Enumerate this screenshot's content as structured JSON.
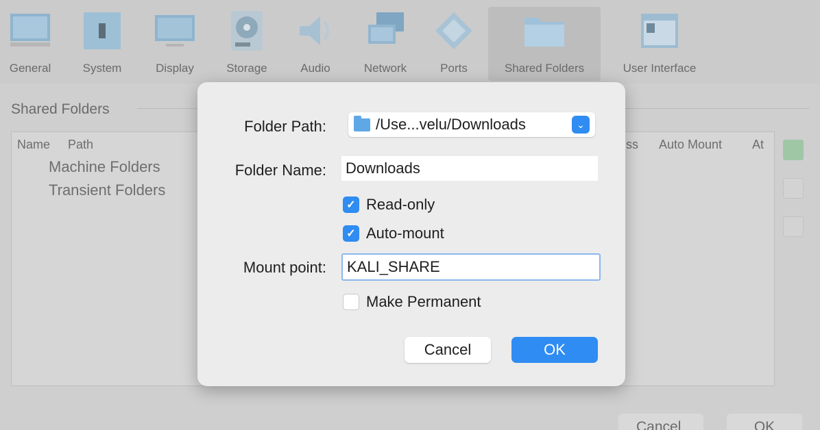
{
  "toolbar": {
    "items": [
      {
        "label": "General",
        "icon": "monitor-icon"
      },
      {
        "label": "System",
        "icon": "chip-icon"
      },
      {
        "label": "Display",
        "icon": "display-icon"
      },
      {
        "label": "Storage",
        "icon": "disk-icon"
      },
      {
        "label": "Audio",
        "icon": "speaker-icon"
      },
      {
        "label": "Network",
        "icon": "network-icon"
      },
      {
        "label": "Ports",
        "icon": "port-icon"
      },
      {
        "label": "Shared Folders",
        "icon": "folder-icon"
      },
      {
        "label": "User Interface",
        "icon": "window-icon"
      }
    ],
    "active": "Shared Folders"
  },
  "shared_folders": {
    "section_title": "Shared Folders",
    "columns": {
      "name": "Name",
      "path": "Path",
      "access": "ss",
      "auto_mount": "Auto Mount",
      "at": "At"
    },
    "rows": [
      "Machine Folders",
      "Transient Folders"
    ]
  },
  "window_buttons": {
    "cancel": "Cancel",
    "ok": "OK"
  },
  "dialog": {
    "folder_path_label": "Folder Path:",
    "folder_path_value": "/Use...velu/Downloads",
    "folder_name_label": "Folder Name:",
    "folder_name_value": "Downloads",
    "read_only_label": "Read-only",
    "read_only_checked": true,
    "auto_mount_label": "Auto-mount",
    "auto_mount_checked": true,
    "mount_point_label": "Mount point:",
    "mount_point_value": "KALI_SHARE",
    "make_permanent_label": "Make Permanent",
    "make_permanent_checked": false,
    "cancel_label": "Cancel",
    "ok_label": "OK"
  },
  "colors": {
    "accent": "#2f8cf2",
    "dialog_bg": "#ececec",
    "window_bg": "#cfcfcf"
  }
}
